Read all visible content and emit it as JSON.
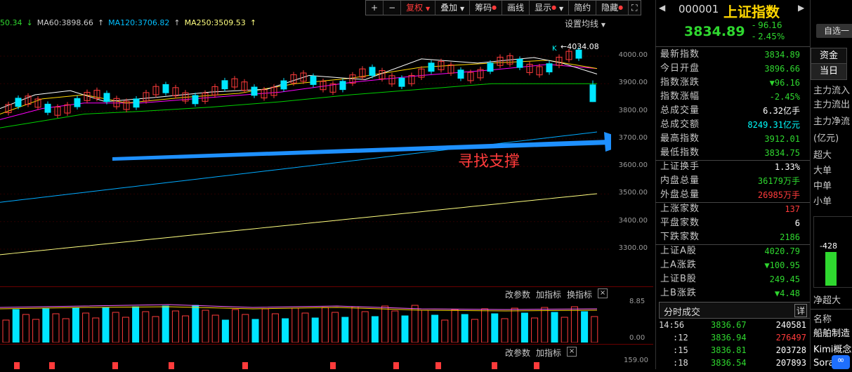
{
  "toolbar": {
    "plus": "+",
    "minus": "−",
    "fuquan": "复权",
    "diejia": "叠加",
    "choumа": "筹码",
    "huaxian": "画线",
    "xianshi": "显示",
    "jianyue": "简约",
    "yincang": "隐藏"
  },
  "ma_bar": {
    "ma_first": "50.34",
    "ma60": "MA60:3898.66",
    "ma120": "MA120:3706.82",
    "ma250": "MA250:3509.53",
    "settings": "设置均线"
  },
  "chart": {
    "high_label": "4034.08",
    "k_marker": "K",
    "annotation": "寻找支撑",
    "y_ticks": [
      "4000.00",
      "3900.00",
      "3800.00",
      "3700.00",
      "3600.00",
      "3500.00",
      "3400.00",
      "3300.00"
    ],
    "colors": {
      "up": "#ff3b3b",
      "down": "#00e5ff",
      "ma5": "#ffffff",
      "ma10": "#ffd700",
      "ma20": "#ff00ff",
      "ma60": "#00d000",
      "ma120": "#00aaff",
      "ma250": "#ffff80",
      "arrow": "#1e90ff"
    }
  },
  "volume": {
    "gaicanshu": "改参数",
    "jiazhibiao": "加指标",
    "huanzhibiao": "换指标",
    "close": "×",
    "y_top": "8.85",
    "y_bottom": "0.00"
  },
  "volume2": {
    "gaicanshu": "改参数",
    "jiazhibiao": "加指标",
    "close": "×",
    "y_top": "159.00"
  },
  "header": {
    "code": "000001",
    "name": "上证指数",
    "price": "3834.89",
    "change": "- 96.16",
    "change_pct": "- 2.45%",
    "zixuan": "自选",
    "zixuan_minus": "一"
  },
  "stats": [
    {
      "k": "最新指数",
      "v": "3834.89",
      "c": "g"
    },
    {
      "k": "今日开盘",
      "v": "3896.66",
      "c": "g"
    },
    {
      "k": "指数涨跌",
      "v": "▼96.16",
      "c": "g"
    },
    {
      "k": "指数涨幅",
      "v": "-2.45%",
      "c": "g"
    },
    {
      "k": "总成交量",
      "v": "6.32亿手",
      "c": "w"
    },
    {
      "k": "总成交额",
      "v": "8249.31亿元",
      "c": "c"
    },
    {
      "k": "最高指数",
      "v": "3912.01",
      "c": "g"
    },
    {
      "k": "最低指数",
      "v": "3834.75",
      "c": "g"
    },
    {
      "k": "上证换手",
      "v": "1.33%",
      "c": "w"
    },
    {
      "k": "内盘总量",
      "v": "36179万手",
      "c": "g"
    },
    {
      "k": "外盘总量",
      "v": "26985万手",
      "c": "r"
    },
    {
      "k": "上涨家数",
      "v": "137",
      "c": "r"
    },
    {
      "k": "平盘家数",
      "v": "6",
      "c": "w"
    },
    {
      "k": "下跌家数",
      "v": "2186",
      "c": "g"
    },
    {
      "k": "上证A股",
      "v": "4020.79",
      "c": "g"
    },
    {
      "k": "上A涨跌",
      "v": "▼100.95",
      "c": "g"
    },
    {
      "k": "上证B股",
      "v": "249.45",
      "c": "g"
    },
    {
      "k": "上B涨跌",
      "v": "▼4.48",
      "c": "g"
    }
  ],
  "ticks_header": {
    "title": "分时成交",
    "detail": "详"
  },
  "ticks": [
    {
      "t": "14:56",
      "p": "3836.67",
      "v": "240581",
      "c": "w"
    },
    {
      "t": ":12",
      "p": "3836.94",
      "v": "276497",
      "c": "r"
    },
    {
      "t": ":15",
      "p": "3836.81",
      "v": "203728",
      "c": "w"
    },
    {
      "t": ":18",
      "p": "3836.54",
      "v": "207893",
      "c": "w"
    }
  ],
  "right2": {
    "zijin": "资金",
    "dangri": "当日",
    "labels": [
      "主力流入",
      "主力流出",
      "主力净流",
      "(亿元)",
      "超大",
      "大单",
      "中单",
      "小单"
    ],
    "bar_value": "-428",
    "bar_label": "净超大",
    "mingcheng": "名称",
    "items": [
      "船舶制造",
      "Kimi概念",
      "Sora"
    ]
  }
}
